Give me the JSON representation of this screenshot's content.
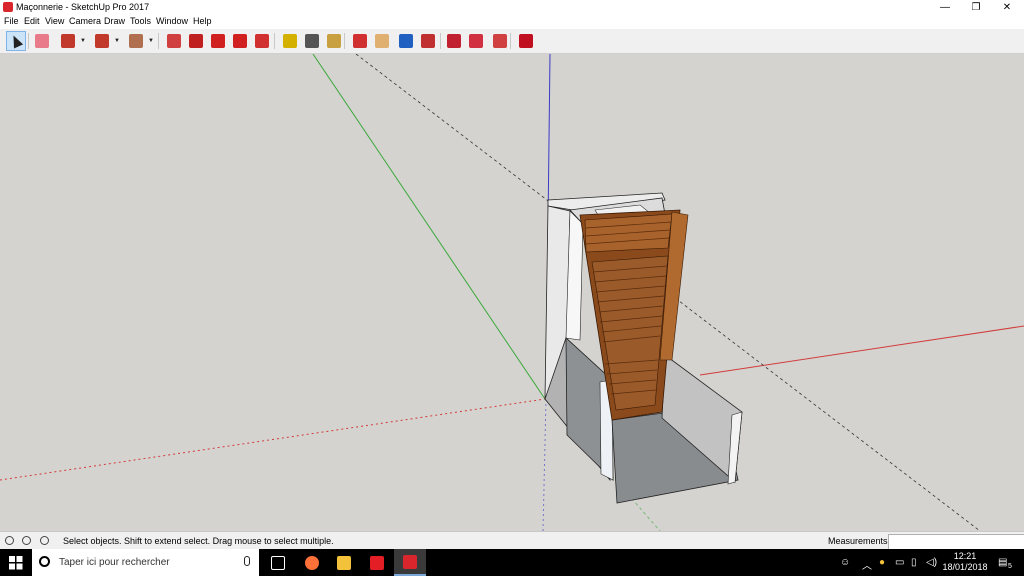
{
  "window": {
    "title": "Maçonnerie - SketchUp Pro 2017",
    "controls": {
      "minimize": "—",
      "restore": "❐",
      "close": "✕"
    }
  },
  "menu": [
    "File",
    "Edit",
    "View",
    "Camera",
    "Draw",
    "Tools",
    "Window",
    "Help"
  ],
  "toolbar": {
    "tools": [
      {
        "name": "select-tool",
        "color": "#333333"
      },
      {
        "name": "eraser-tool",
        "color": "#e87a8a"
      },
      {
        "name": "line-tool",
        "color": "#c0392b"
      },
      {
        "name": "arc-tool",
        "color": "#c0392b"
      },
      {
        "name": "shape-tool",
        "color": "#b07050"
      },
      {
        "name": "push-pull-tool",
        "color": "#d04040"
      },
      {
        "name": "offset-tool",
        "color": "#c02020"
      },
      {
        "name": "move-tool",
        "color": "#d02020"
      },
      {
        "name": "rotate-tool",
        "color": "#d02020"
      },
      {
        "name": "scale-tool",
        "color": "#d03030"
      },
      {
        "name": "tape-measure-tool",
        "color": "#d4b000"
      },
      {
        "name": "text-tool",
        "color": "#555555"
      },
      {
        "name": "paint-bucket-tool",
        "color": "#c8a040"
      },
      {
        "name": "orbit-tool",
        "color": "#d03030"
      },
      {
        "name": "pan-tool",
        "color": "#e0b070"
      },
      {
        "name": "zoom-tool",
        "color": "#2060c0"
      },
      {
        "name": "zoom-extents-tool",
        "color": "#c03030"
      },
      {
        "name": "warehouse-tool",
        "color": "#c02030"
      },
      {
        "name": "extension-tool",
        "color": "#d03040"
      },
      {
        "name": "send-layout-tool",
        "color": "#d04040"
      },
      {
        "name": "ruby-tool",
        "color": "#c01020"
      }
    ]
  },
  "status": {
    "message": "Select objects. Shift to extend select. Drag mouse to select multiple.",
    "measurements_label": "Measurements",
    "measurements_value": ""
  },
  "taskbar": {
    "search_placeholder": "Taper ici pour rechercher",
    "time": "12:21",
    "date": "18/01/2018",
    "notification_count": "5",
    "apps": [
      {
        "name": "task-view-icon",
        "color": "#ffffff"
      },
      {
        "name": "firefox-icon",
        "color": "#ff7139"
      },
      {
        "name": "file-explorer-icon",
        "color": "#f3c13a"
      },
      {
        "name": "autocad-icon",
        "color": "#e31e24"
      },
      {
        "name": "sketchup-taskbar-icon",
        "color": "#d9262c"
      }
    ]
  },
  "colors": {
    "viewport_bg": "#d4d3cf",
    "wall_light": "#e6e6e6",
    "wall_mid": "#bdbdbd",
    "wall_dark": "#8e9193",
    "wood": "#9a5a2a",
    "wood_dark": "#6a3410",
    "axis_red": "#d23b3b",
    "axis_green": "#3aa83a",
    "axis_blue": "#3a3ac8"
  }
}
